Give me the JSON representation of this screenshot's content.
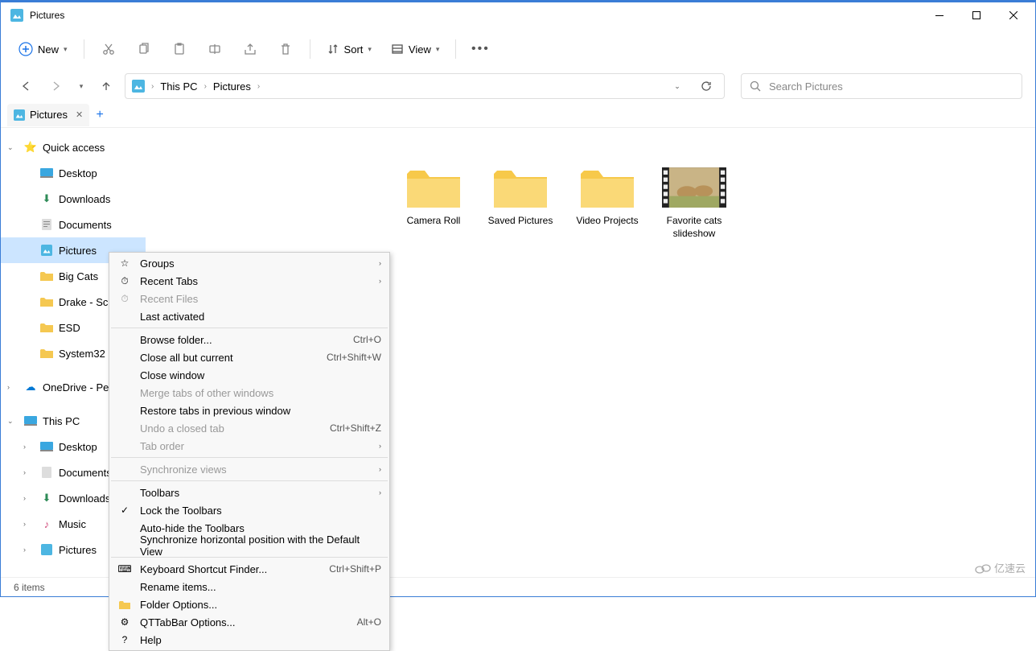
{
  "window": {
    "title": "Pictures"
  },
  "toolbar": {
    "new_label": "New",
    "sort_label": "Sort",
    "view_label": "View"
  },
  "breadcrumb": {
    "root": "This PC",
    "current": "Pictures"
  },
  "search": {
    "placeholder": "Search Pictures"
  },
  "tabs": {
    "active": "Pictures"
  },
  "sidebar": {
    "quick_access": "Quick access",
    "desktop": "Desktop",
    "downloads": "Downloads",
    "documents": "Documents",
    "pictures": "Pictures",
    "big_cats": "Big Cats",
    "drake": "Drake - Scorpion",
    "esd": "ESD",
    "system32": "System32",
    "onedrive": "OneDrive - Personal",
    "this_pc": "This PC",
    "pc_desktop": "Desktop",
    "pc_documents": "Documents",
    "pc_downloads": "Downloads",
    "pc_music": "Music",
    "pc_pictures": "Pictures"
  },
  "files": {
    "camera_roll": "Camera Roll",
    "saved_pictures": "Saved Pictures",
    "video_projects": "Video Projects",
    "favorite_cats": "Favorite cats slideshow"
  },
  "context_menu": {
    "groups": {
      "label": "Groups"
    },
    "recent_tabs": {
      "label": "Recent Tabs"
    },
    "recent_files": {
      "label": "Recent Files"
    },
    "last_activated": {
      "label": "Last activated"
    },
    "browse_folder": {
      "label": "Browse folder...",
      "shortcut": "Ctrl+O"
    },
    "close_all": {
      "label": "Close all but current",
      "shortcut": "Ctrl+Shift+W"
    },
    "close_window": {
      "label": "Close window"
    },
    "merge_tabs": {
      "label": "Merge tabs of other windows"
    },
    "restore_tabs": {
      "label": "Restore tabs in previous window"
    },
    "undo_closed": {
      "label": "Undo a closed tab",
      "shortcut": "Ctrl+Shift+Z"
    },
    "tab_order": {
      "label": "Tab order"
    },
    "sync_views": {
      "label": "Synchronize views"
    },
    "toolbars": {
      "label": "Toolbars"
    },
    "lock_toolbars": {
      "label": "Lock the Toolbars"
    },
    "autohide": {
      "label": "Auto-hide the Toolbars"
    },
    "sync_horiz": {
      "label": "Synchronize horizontal position with the Default View"
    },
    "kb_shortcut": {
      "label": "Keyboard Shortcut Finder...",
      "shortcut": "Ctrl+Shift+P"
    },
    "rename": {
      "label": "Rename items..."
    },
    "folder_options": {
      "label": "Folder Options..."
    },
    "qttab_options": {
      "label": "QTTabBar Options...",
      "shortcut": "Alt+O"
    },
    "help": {
      "label": "Help"
    }
  },
  "status": {
    "item_count": "6 items"
  },
  "watermark": "亿速云"
}
